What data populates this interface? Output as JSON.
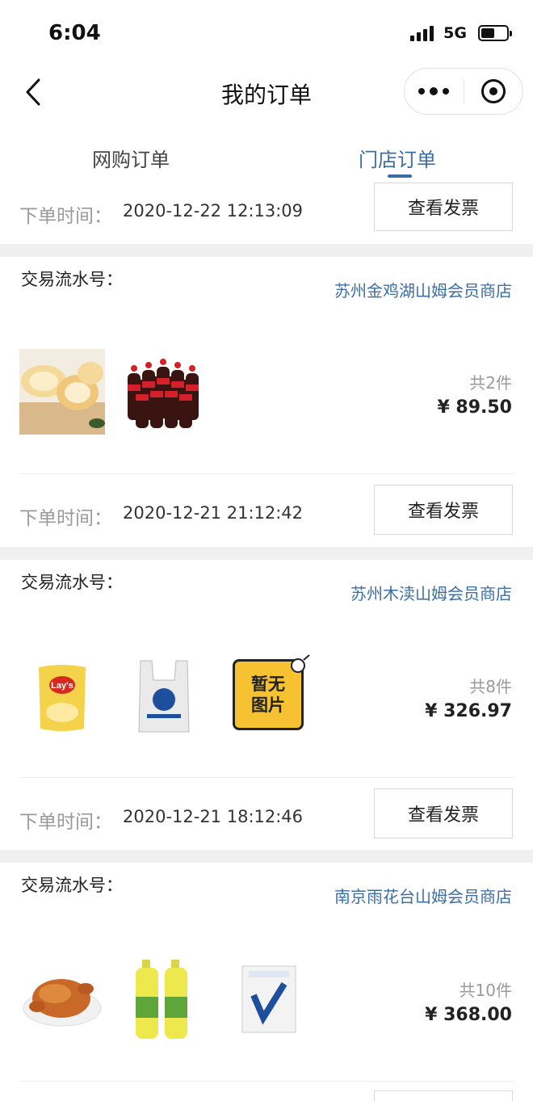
{
  "status_bar": {
    "time": "6:04",
    "network": "5G"
  },
  "nav": {
    "title": "我的订单"
  },
  "tabs": [
    {
      "label": "网购订单",
      "active": false
    },
    {
      "label": "门店订单",
      "active": true
    }
  ],
  "colors": {
    "accent": "#3b6ea5",
    "muted": "#9a9a9a",
    "separator": "#f0f0f0"
  },
  "labels": {
    "order_time": "下单时间：",
    "serial_no": "交易流水号：",
    "invoice_button": "查看发票"
  },
  "top_partial_order": {
    "order_time": "2020-12-22 12:13:09"
  },
  "orders": [
    {
      "store": "苏州金鸡湖山姆会员商店",
      "products": [
        "bread-rolls",
        "cola-pack"
      ],
      "count": "共2件",
      "price": "¥ 89.50",
      "order_time": "2020-12-21 21:12:42"
    },
    {
      "store": "苏州木渎山姆会员商店",
      "products": [
        "lays-chips",
        "shopping-bag",
        "no-image-placeholder"
      ],
      "no_image_text": [
        "暂无",
        "图片"
      ],
      "count": "共8件",
      "price": "¥ 326.97",
      "order_time": "2020-12-21 18:12:46"
    },
    {
      "store": "南京雨花台山姆会员商店",
      "products": [
        "roast-chicken",
        "juice-bottles",
        "tissue-pack"
      ],
      "count": "共10件",
      "price": "¥ 368.00"
    }
  ]
}
